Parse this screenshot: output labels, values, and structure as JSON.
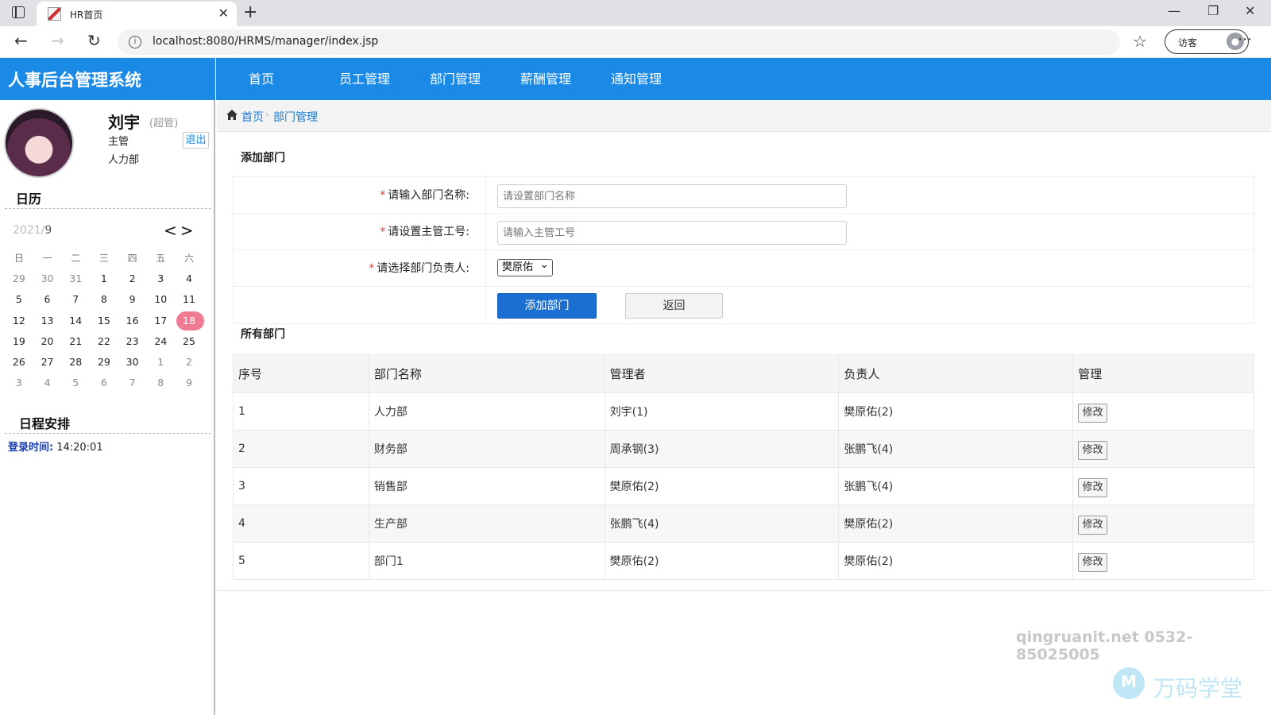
{
  "browser": {
    "tab_title": "HR首页",
    "url": "localhost:8080/HRMS/manager/index.jsp",
    "profile_label": "访客",
    "icons": [
      "sidebar-toggle-icon",
      "favicon-icon",
      "close-icon",
      "plus-icon",
      "minimize-icon",
      "restore-icon",
      "close-window-icon",
      "back-icon",
      "forward-icon",
      "refresh-icon",
      "info-icon",
      "favorites-icon",
      "profile-avatar-icon",
      "more-icon"
    ]
  },
  "app": {
    "title": "人事后台管理系统",
    "accent_color": "#1a8ae6",
    "nav": [
      "首页",
      "员工管理",
      "部门管理",
      "薪酬管理",
      "通知管理"
    ]
  },
  "user": {
    "name": "刘宇",
    "role": "(超管)",
    "title": "主管",
    "dept": "人力部",
    "logout_label": "退出"
  },
  "calendar": {
    "heading": "日历",
    "year": "2021/",
    "month": "9",
    "prev_label": "<",
    "next_label": ">",
    "weekdays": [
      "日",
      "一",
      "二",
      "三",
      "四",
      "五",
      "六"
    ],
    "rows": [
      [
        "29",
        "30",
        "31",
        "1",
        "2",
        "3",
        "4"
      ],
      [
        "5",
        "6",
        "7",
        "8",
        "9",
        "10",
        "11"
      ],
      [
        "12",
        "13",
        "14",
        "15",
        "16",
        "17",
        "18"
      ],
      [
        "19",
        "20",
        "21",
        "22",
        "23",
        "24",
        "25"
      ],
      [
        "26",
        "27",
        "28",
        "29",
        "30",
        "1",
        "2"
      ],
      [
        "3",
        "4",
        "5",
        "6",
        "7",
        "8",
        "9"
      ]
    ],
    "today": "18",
    "today_color": "#f07a92"
  },
  "schedule": {
    "heading": "日程安排",
    "login_label": "登录时间:",
    "login_time": "14:20:01"
  },
  "breadcrumb": [
    "首页",
    "部门管理"
  ],
  "add_form": {
    "title": "添加部门",
    "name_label": "请输入部门名称:",
    "name_placeholder": "请设置部门名称",
    "manager_label": "请设置主管工号:",
    "manager_placeholder": "请输入主管工号",
    "head_label": "请选择部门负责人:",
    "head_selected": "樊原佑",
    "submit_label": "添加部门",
    "back_label": "返回"
  },
  "dept_table": {
    "title": "所有部门",
    "columns": [
      "序号",
      "部门名称",
      "管理者",
      "负责人",
      "管理"
    ],
    "rows": [
      {
        "no": "1",
        "name": "人力部",
        "manager": "刘宇(1)",
        "head": "樊原佑(2)",
        "action": "修改"
      },
      {
        "no": "2",
        "name": "财务部",
        "manager": "周承钢(3)",
        "head": "张鹏飞(4)",
        "action": "修改"
      },
      {
        "no": "3",
        "name": "销售部",
        "manager": "樊原佑(2)",
        "head": "张鹏飞(4)",
        "action": "修改"
      },
      {
        "no": "4",
        "name": "生产部",
        "manager": "张鹏飞(4)",
        "head": "樊原佑(2)",
        "action": "修改"
      },
      {
        "no": "5",
        "name": "部门1",
        "manager": "樊原佑(2)",
        "head": "樊原佑(2)",
        "action": "修改"
      }
    ]
  },
  "watermark": {
    "contact": "qingruanit.net 0532-85025005",
    "brand": "万码学堂"
  }
}
